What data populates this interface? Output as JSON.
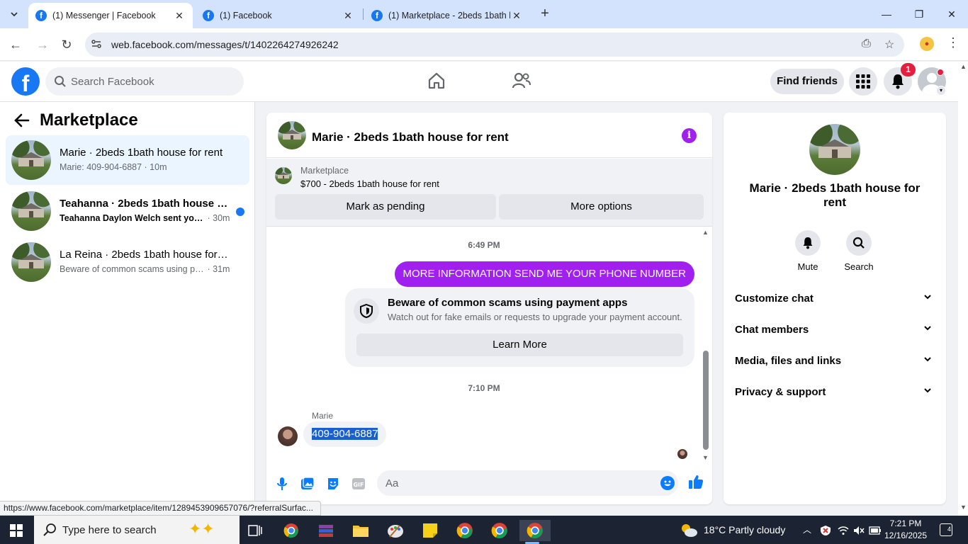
{
  "browser": {
    "tabs": [
      {
        "label": "(1) Messenger | Facebook",
        "active": true
      },
      {
        "label": "(1) Facebook",
        "active": false
      },
      {
        "label": "(1) Marketplace - 2beds 1bath h",
        "active": false
      }
    ],
    "url": "web.facebook.com/messages/t/1402264274926242",
    "status_url": "https://www.facebook.com/marketplace/item/1289453909657076/?referralSurfac..."
  },
  "header": {
    "logo": "f",
    "search_placeholder": "Search Facebook",
    "find_friends_label": "Find friends",
    "notifications_count": "1"
  },
  "sidebar": {
    "title": "Marketplace",
    "conversations": [
      {
        "name": "Marie · 2beds 1bath house for rent",
        "preview": "Marie: 409-904-6887",
        "time": "· 10m",
        "active": true,
        "unread": false
      },
      {
        "name": "Teahanna · 2beds 1bath house fo...",
        "preview": "Teahanna Daylon Welch sent you...",
        "time": "· 30m",
        "active": false,
        "unread": true
      },
      {
        "name": "La Reina · 2beds 1bath house for r...",
        "preview": "Beware of common scams using pa...",
        "time": "· 31m",
        "active": false,
        "unread": false
      }
    ]
  },
  "chat": {
    "title": "Marie · 2beds 1bath house for rent",
    "marketplace_label": "Marketplace",
    "listing": "$700 - 2beds 1bath house for rent",
    "mark_pending_label": "Mark as pending",
    "more_options_label": "More options",
    "timestamp1": "6:49 PM",
    "outgoing_message": "MORE INFORMATION SEND ME YOUR PHONE NUMBER",
    "scam_title": "Beware of common scams using payment apps",
    "scam_desc": "Watch out for fake emails or requests to upgrade your payment account.",
    "learn_more_label": "Learn More",
    "timestamp2": "7:10 PM",
    "sender_name": "Marie",
    "incoming_message": "409-904-6887",
    "input_placeholder": "Aa"
  },
  "info_panel": {
    "name": "Marie · 2beds 1bath house for rent",
    "actions": [
      {
        "label": "Mute",
        "icon": "bell-icon"
      },
      {
        "label": "Search",
        "icon": "search-icon"
      }
    ],
    "sections": [
      {
        "label": "Customize chat"
      },
      {
        "label": "Chat members"
      },
      {
        "label": "Media, files and links"
      },
      {
        "label": "Privacy & support"
      }
    ]
  },
  "taskbar": {
    "search_placeholder": "Type here to search",
    "weather": "18°C  Partly cloudy",
    "time": "7:21 PM",
    "date": "12/16/2025",
    "notification_count": "4"
  },
  "colors": {
    "fb_blue": "#1877f2",
    "messenger_purple": "#a020f0",
    "active_conv_bg": "#ebf5ff",
    "taskbar": "#1c2433"
  }
}
